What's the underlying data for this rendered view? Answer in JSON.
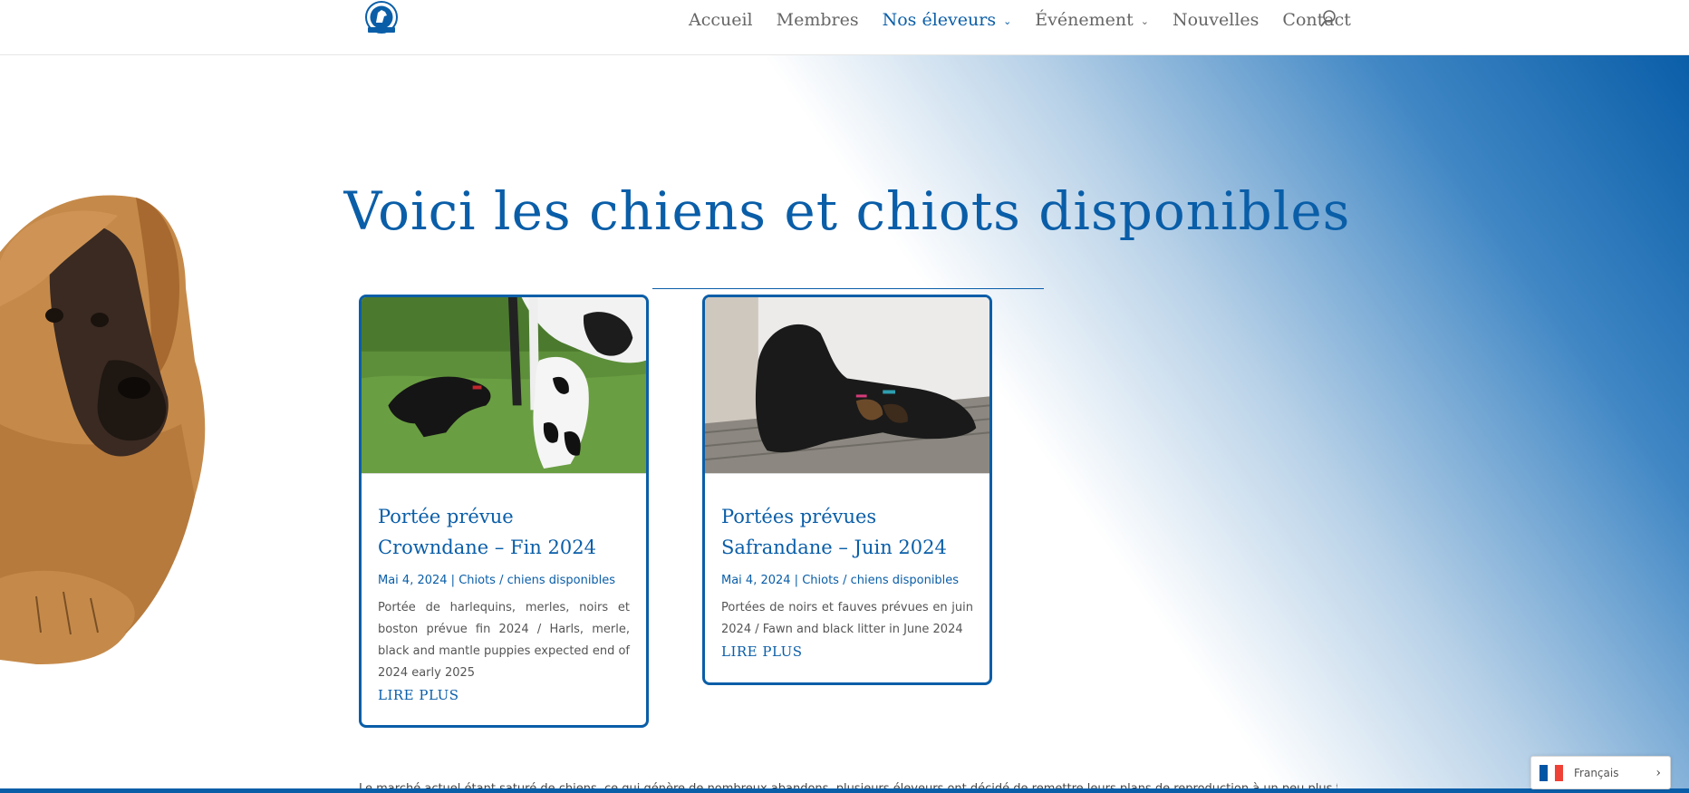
{
  "header": {
    "logo_icon": "club-seal-logo",
    "nav": [
      {
        "label": "Accueil",
        "has_dropdown": false
      },
      {
        "label": "Membres",
        "has_dropdown": false
      },
      {
        "label": "Nos éleveurs",
        "has_dropdown": true,
        "active": true
      },
      {
        "label": "Événement",
        "has_dropdown": true
      },
      {
        "label": "Nouvelles",
        "has_dropdown": false
      },
      {
        "label": "Contact",
        "has_dropdown": false
      }
    ],
    "search_icon": "search-icon"
  },
  "hero": {
    "title": "Voici les chiens et chiots disponibles"
  },
  "cards": [
    {
      "title": "Portée prévue Crowndane – Fin 2024",
      "date": "Mai 4, 2024",
      "separator": " | ",
      "category": "Chiots / chiens disponibles",
      "excerpt": "Portée de harlequins, merles, noirs et boston prévue fin 2024 / Harls, merle, black and mantle puppies expected end of 2024 early 2025",
      "more": "LIRE PLUS"
    },
    {
      "title": "Portées prévues Safrandane – Juin 2024",
      "date": "Mai 4, 2024",
      "separator": " | ",
      "category": "Chiots / chiens disponibles",
      "excerpt": "Portées de noirs et fauves prévues en juin 2024 / Fawn and black litter in June 2024",
      "more": "LIRE PLUS"
    }
  ],
  "footer_text": "Le marché actuel étant saturé de chiens, ce qui génère de nombreux abandons, plusieurs éleveurs ont décidé de remettre leurs plans de reproduction à un peu plus tard ou de",
  "language": {
    "label": "Français",
    "flag": "france-flag-icon"
  },
  "colors": {
    "accent": "#0a5ea8",
    "nav_text": "#666666"
  }
}
